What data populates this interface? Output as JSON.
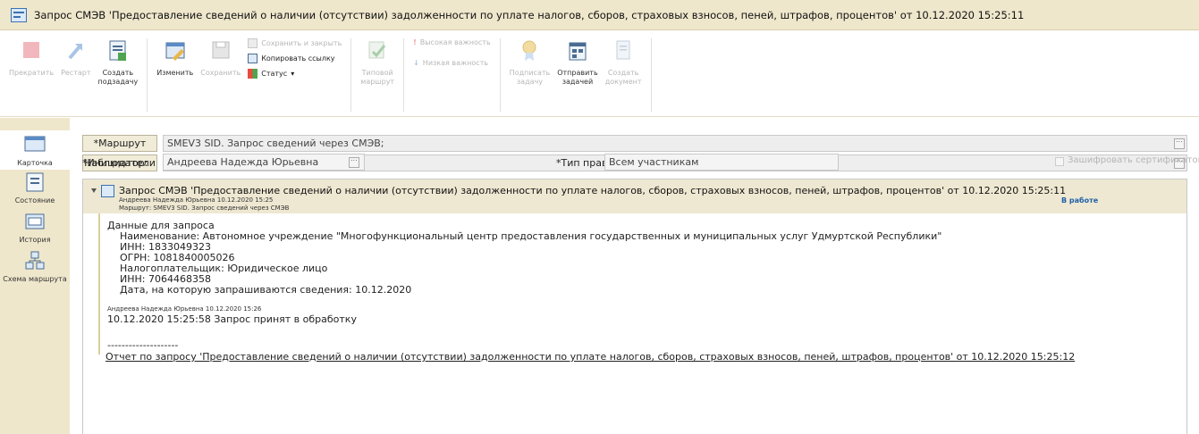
{
  "window": {
    "title": "Запрос СМЭВ 'Предоставление сведений о наличии (отсутствии) задолженности по уплате налогов, сборов, страховых взносов, пеней, штрафов, процентов' от 10.12.2020 15:25:11"
  },
  "toolbar": {
    "stop": "Прекратить",
    "restart": "Рестарт",
    "create_subtask_1": "Создать",
    "create_subtask_2": "подзадачу",
    "edit": "Изменить",
    "save": "Сохранить",
    "save_close": "Сохранить и закрыть",
    "copy_link": "Копировать ссылку",
    "status": "Статус",
    "typical_route_1": "Типовой",
    "typical_route_2": "маршрут",
    "high_importance": "Высокая важность",
    "low_importance": "Низкая важность",
    "sign_task_1": "Подписать",
    "sign_task_2": "задачу",
    "send_task_1": "Отправить",
    "send_task_2": "задачей",
    "create_doc_1": "Создать",
    "create_doc_2": "документ"
  },
  "leftnav": {
    "card": "Карточка",
    "state": "Состояние",
    "history": "История",
    "route_scheme": "Схема маршрута"
  },
  "form": {
    "route_btn": "*Маршрут",
    "route_value": "SMEV3 SID. Запрос сведений через СМЭВ;",
    "observers_btn": "Наблюдатели",
    "observers_value": "",
    "initiator_label": "*Инициатор:",
    "initiator_value": "Андреева Надежда Юрьевна",
    "rights_label": "*Тип прав:",
    "rights_value": "Всем участникам",
    "encrypt_label": "Зашифровать сертификатом"
  },
  "task": {
    "title": "Запрос СМЭВ 'Предоставление сведений о наличии (отсутствии) задолженности по уплате налогов, сборов, страховых взносов, пеней, штрафов, процентов' от 10.12.2020 15:25:11",
    "author_line": "Андреева Надежда Юрьевна 10.12.2020 15:25",
    "route_line": "Маршрут: SMEV3 SID. Запрос сведений через СМЭВ",
    "status": "В работе",
    "body": [
      "Данные для запроса",
      "    Наименование: Автономное учреждение \"Многофункциональный центр предоставления государственных и муниципальных услуг Удмуртской Республики\"",
      "    ИНН: 1833049323",
      "    ОГРН: 1081840005026",
      "    Налогоплательщик: Юридическое лицо",
      "    ИНН: 7064468358",
      "    Дата, на которую запрашиваются сведения: 10.12.2020"
    ],
    "comment_meta": "Андреева Надежда Юрьевна 10.12.2020 15:26",
    "comment_text": "10.12.2020 15:25:58 Запрос принят в обработку",
    "divider": "--------------------",
    "report_link": "Отчет по запросу 'Предоставление сведений о наличии (отсутствии) задолженности по уплате налогов, сборов, страховых взносов, пеней, штрафов, процентов' от 10.12.2020 15:25:12"
  }
}
